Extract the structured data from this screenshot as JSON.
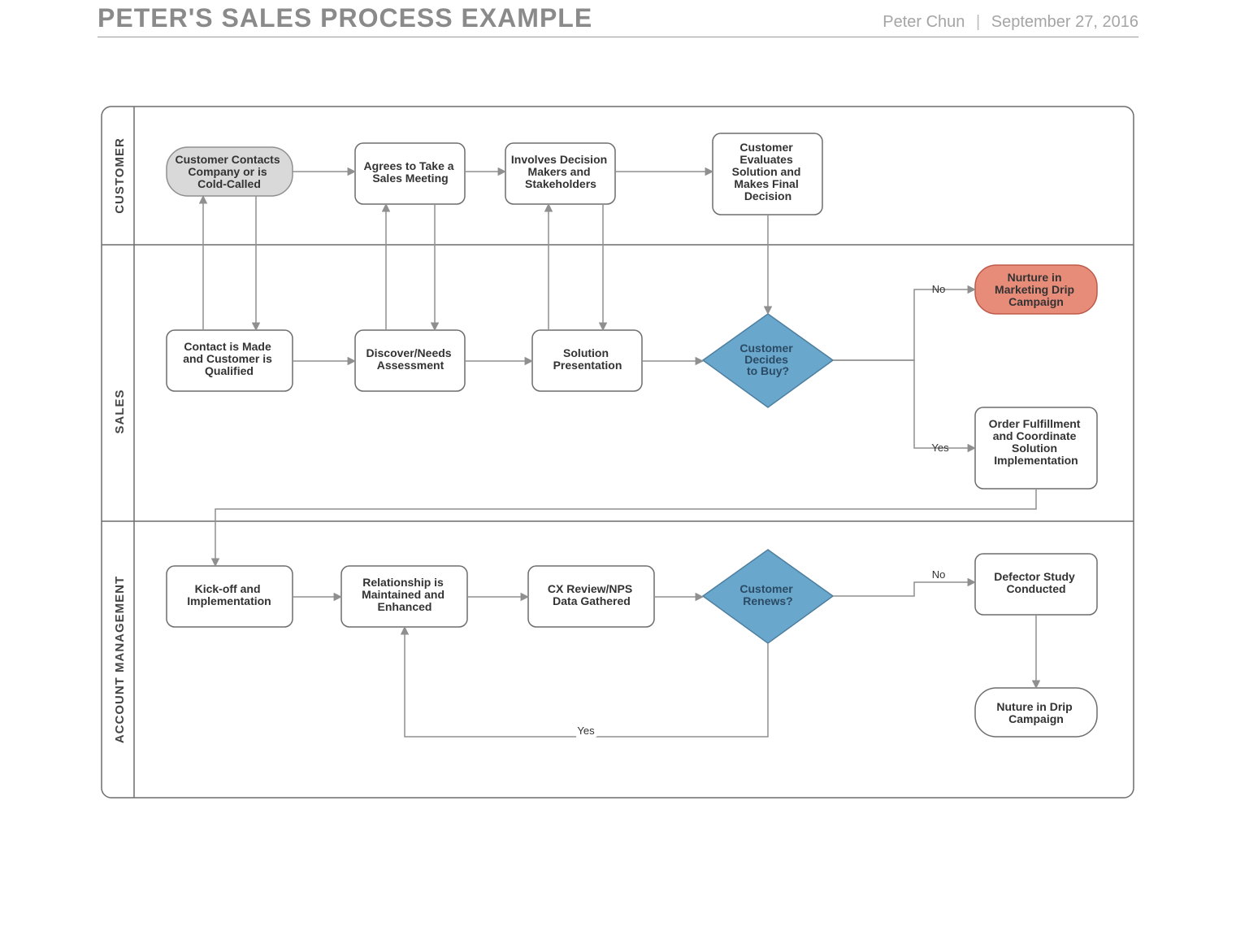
{
  "header": {
    "title": "PETER'S SALES PROCESS EXAMPLE",
    "author": "Peter Chun",
    "date": "September 27, 2016"
  },
  "lanes": {
    "customer": "CUSTOMER",
    "sales": "SALES",
    "account": "ACCOUNT MANAGEMENT"
  },
  "nodes": {
    "c1": "Customer Contacts Company or is Cold-Called",
    "c2": "Agrees to Take a Sales Meeting",
    "c3": "Involves Decision Makers and Stakeholders",
    "c4": "Customer Evaluates Solution and Makes Final Decision",
    "s1": "Contact is Made and Customer is Qualified",
    "s2": "Discover/Needs Assessment",
    "s3": "Solution Presentation",
    "s4": "Customer Decides to Buy?",
    "s5": "Nurture in Marketing Drip Campaign",
    "s6": "Order Fulfillment and Coordinate Solution Implementation",
    "a1": "Kick-off and Implementation",
    "a2": "Relationship is Maintained and Enhanced",
    "a3": "CX Review/NPS Data Gathered",
    "a4": "Customer Renews?",
    "a5": "Defector Study Conducted",
    "a6": "Nuture in Drip Campaign"
  },
  "labels": {
    "no": "No",
    "yes": "Yes"
  }
}
